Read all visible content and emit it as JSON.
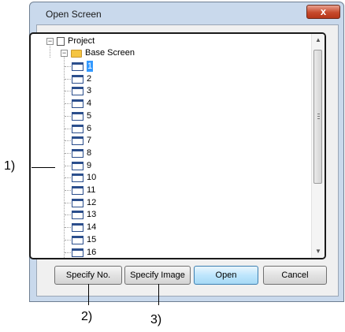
{
  "window": {
    "title": "Open Screen",
    "close_glyph": "x"
  },
  "tree": {
    "root_label": "Project",
    "folder_label": "Base Screen",
    "items": [
      "1",
      "2",
      "3",
      "4",
      "5",
      "6",
      "7",
      "8",
      "9",
      "10",
      "11",
      "12",
      "13",
      "14",
      "15",
      "16"
    ],
    "selected_item": "1",
    "expander_glyph": "−"
  },
  "buttons": {
    "specify_no": "Specify No.",
    "specify_image": "Specify Image",
    "open": "Open",
    "cancel": "Cancel"
  },
  "callouts": {
    "tree": "1)",
    "specify_no": "2)",
    "specify_image": "3)"
  },
  "colors": {
    "selection": "#3399ff",
    "folder": "#f5c542",
    "close_button": "#c74a2c"
  }
}
